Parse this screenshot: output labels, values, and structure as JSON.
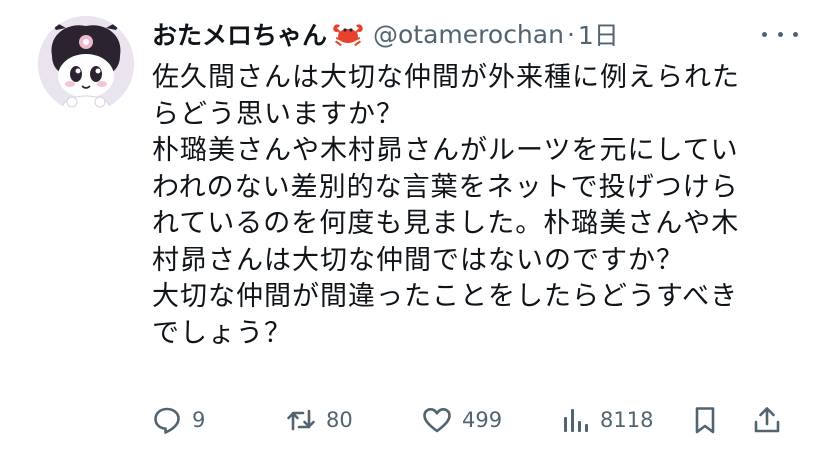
{
  "tweet": {
    "display_name": "おたメロちゃん",
    "handle": "@otamerochan",
    "separator": "·",
    "time": "1日",
    "body_lines": [
      "佐久間さんは大切な仲間が外来種に例えられた",
      "らどう思いますか？",
      "朴璐美さんや木村昴さんがルーツを元にしてい",
      "われのない差別的な言葉をネットで投げつけら",
      "れているのを何度も見ました。朴璐美さんや木",
      "村昴さんは大切な仲間ではないのですか？",
      "大切な仲間が間違ったことをしたらどうすべき",
      "でしょう？"
    ]
  },
  "actions": {
    "reply_count": "9",
    "retweet_count": "80",
    "like_count": "499",
    "views_count": "8118"
  },
  "icons": {
    "emoji": "crab-emoji",
    "more": "more-icon",
    "reply": "reply-icon",
    "retweet": "retweet-icon",
    "like": "heart-icon",
    "views": "views-icon",
    "bookmark": "bookmark-icon",
    "share": "share-icon"
  },
  "colors": {
    "text": "#0f1419",
    "secondary": "#536471",
    "crab": "#e8412c"
  }
}
